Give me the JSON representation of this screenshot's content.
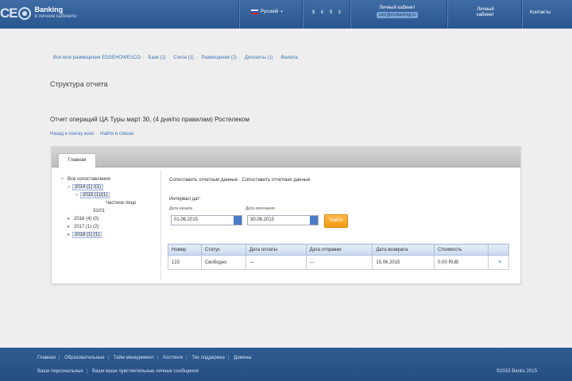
{
  "header": {
    "logo_mark": "CE",
    "logo_title": "Banking",
    "logo_subtitle": "в личном кабинете",
    "language": "Русский",
    "rates": "$ € $ £",
    "account_name": "Личный кабинет",
    "account_email": "user@ecobanking.ru",
    "personal_line1": "Личный",
    "personal_line2": "кабинет",
    "contacts": "Контакты"
  },
  "breadcrumb": [
    "Все мои размещения EDGEHOWEXCO",
    "Банк (1)",
    "Счета (1)",
    "Размещение (2)",
    "Депозиты (1)",
    "Валюта"
  ],
  "page_title": "Структура отчета",
  "report": {
    "title": "Отчет операций ЦА Туры март 30, (4 дня/по правилам) Ростелеком",
    "links": [
      "Назад к списку всех",
      "Найти в списке"
    ]
  },
  "panel": {
    "tab_label": "Главная",
    "tree": [
      {
        "level": 0,
        "toggle": "▿",
        "label": "Все сопоставления",
        "selected": false
      },
      {
        "level": 1,
        "toggle": "▿",
        "label": "2014 (1) /(1)",
        "selected": true
      },
      {
        "level": 2,
        "toggle": "▿",
        "label": "2015 (1)/(1)",
        "selected": true
      },
      {
        "level": 3,
        "toggle": "",
        "label": "Частное лицо",
        "selected": false
      },
      {
        "level": 3,
        "toggle": "",
        "label": "31/01",
        "selected": false
      },
      {
        "level": 1,
        "toggle": "▸",
        "label": "2016 (4) (0)",
        "selected": false
      },
      {
        "level": 1,
        "toggle": "▸",
        "label": "2017 (1) (2)",
        "selected": false
      },
      {
        "level": 1,
        "toggle": "▸",
        "label": "2018 (1) (1)",
        "selected": true
      }
    ],
    "summary_links": "Сопоставить отчетные данные · Сопоставить отчетные данные",
    "period_label": "Интервал дат:",
    "from_label": "Дата начала",
    "to_label": "Дата окончания",
    "from_value": "01.06.2015",
    "to_value": "30.06.2015",
    "show_button": "Найти",
    "table": {
      "columns": [
        "Номер",
        "Статус",
        "Дата оплаты",
        "Дата отправки",
        "Дата возврата",
        "Стоимость",
        ""
      ],
      "rows": [
        [
          "123",
          "Свободно",
          "—",
          "—",
          "15.06.2015",
          "0,00 RUB",
          "✎"
        ]
      ]
    }
  },
  "footer": {
    "row1": [
      "Главная",
      "Образовательные",
      "Тайм менеджмент",
      "Хостинги",
      "Тех поддержка",
      "Домены"
    ],
    "row2": [
      "Ваши персональные",
      "Ваши ваши чувствительные личные сообщения"
    ],
    "copyright": "©2015 Banks 2015"
  }
}
